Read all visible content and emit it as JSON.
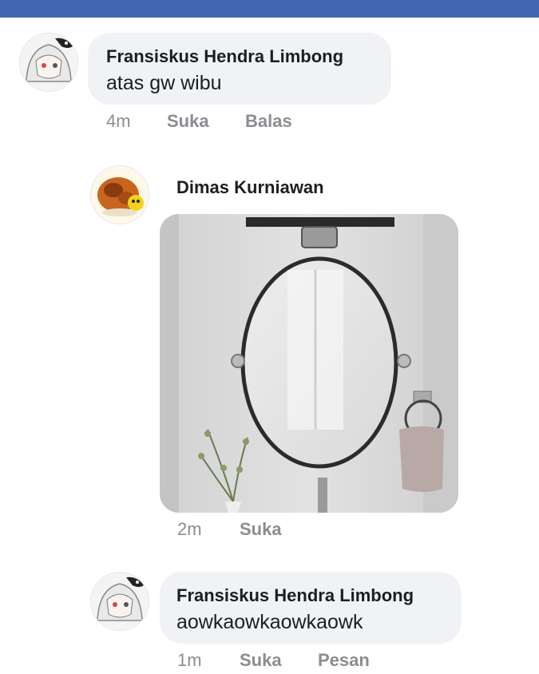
{
  "comments": [
    {
      "author": "Fransiskus Hendra Limbong",
      "text": "atas gw wibu",
      "time": "4m",
      "like_label": "Suka",
      "reply_label": "Balas"
    },
    {
      "author": "Dimas Kurniawan",
      "time": "2m",
      "like_label": "Suka"
    },
    {
      "author": "Fransiskus Hendra Limbong",
      "text": "aowkaowkaowkaowk",
      "time": "1m",
      "like_label": "Suka",
      "reply_label": "Pesan"
    }
  ],
  "colors": {
    "header": "#4267b2",
    "bubble": "#f0f2f5",
    "meta_text": "#8a8d91"
  }
}
